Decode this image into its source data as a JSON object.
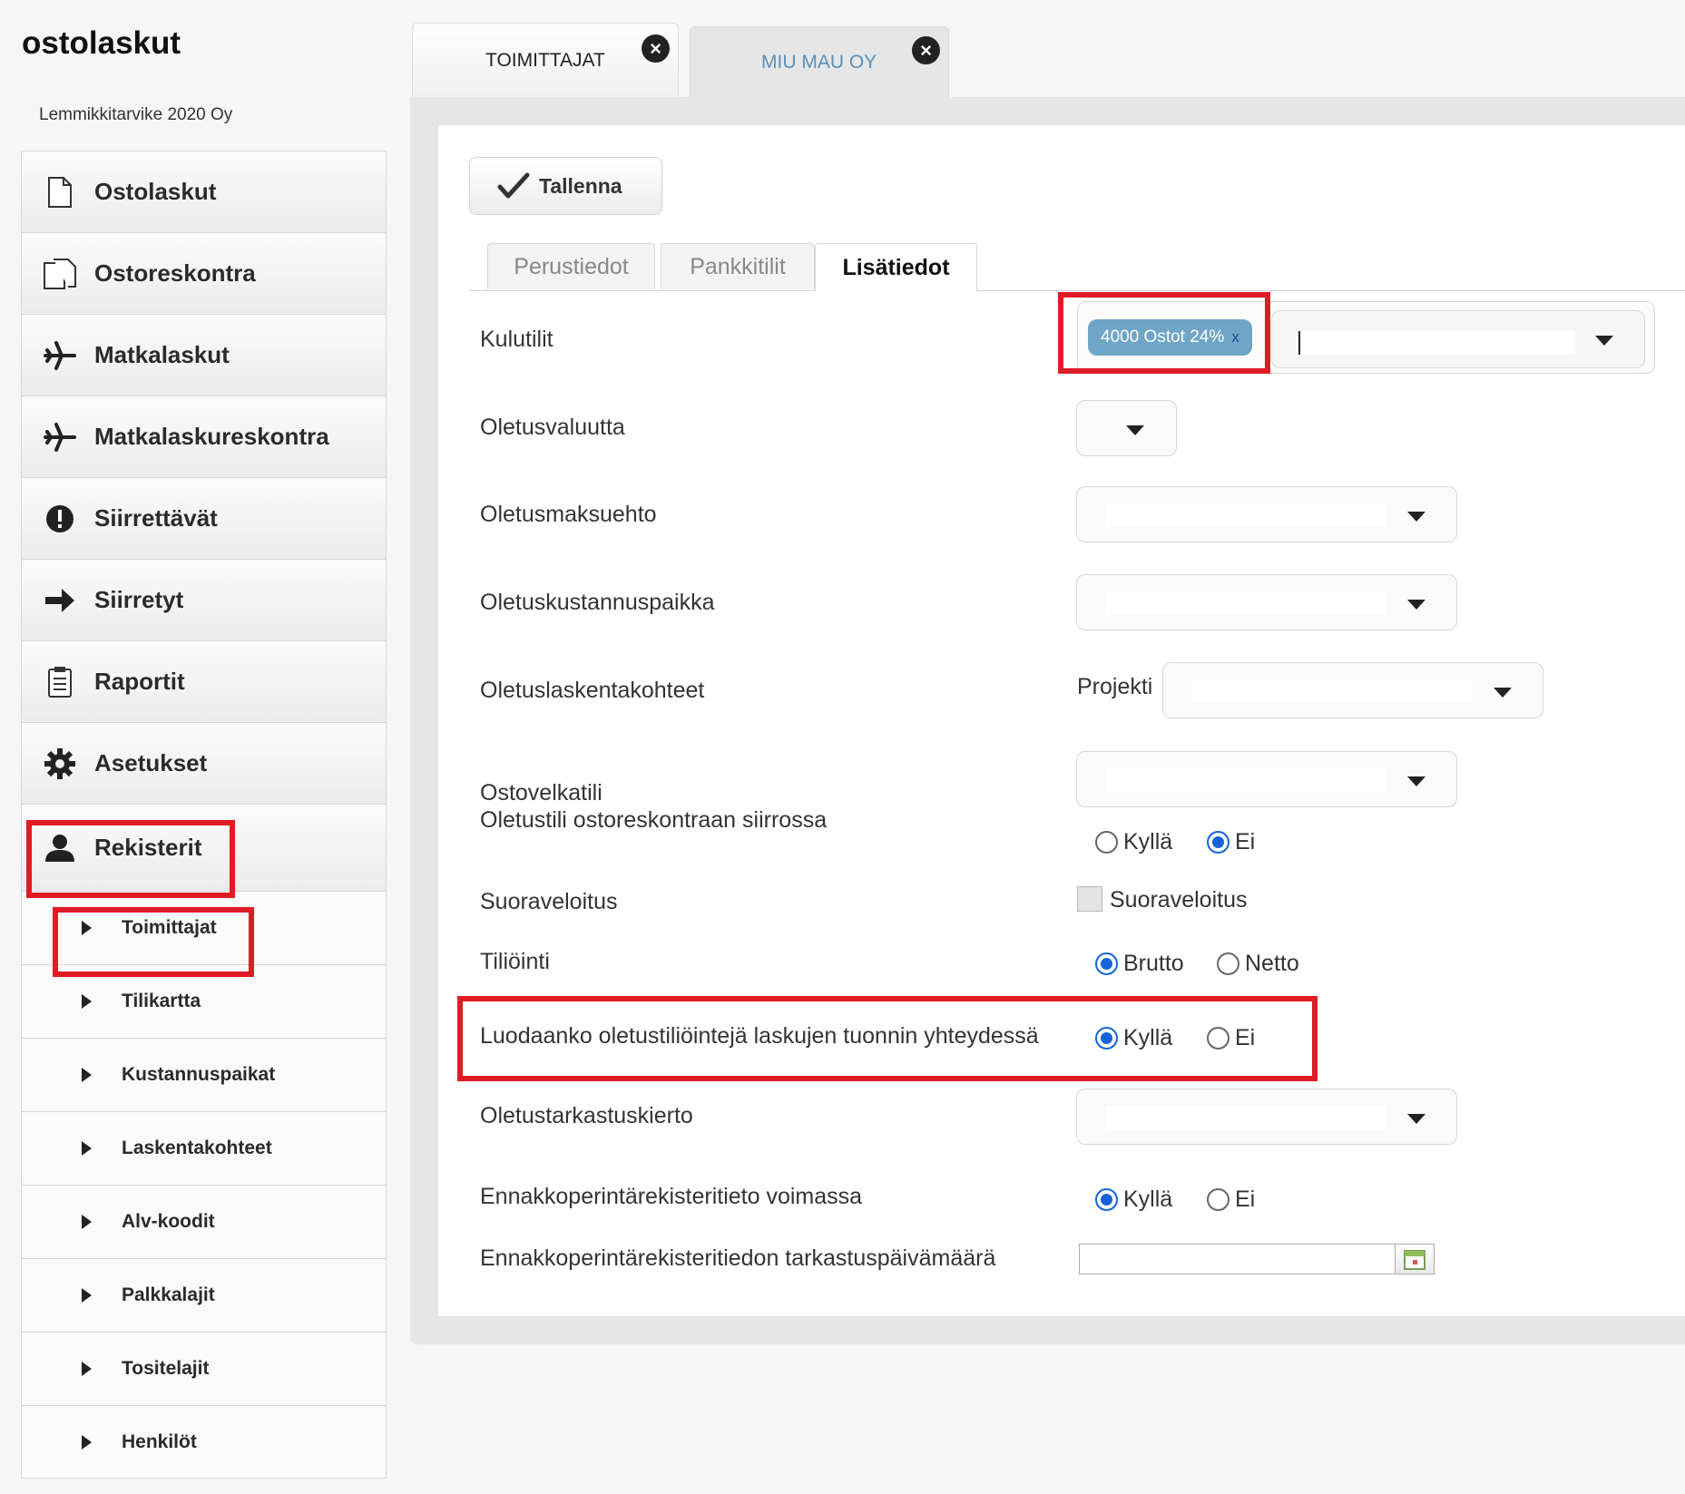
{
  "app": {
    "title": "ostolaskut",
    "company": "Lemmikkitarvike 2020 Oy"
  },
  "sidebar": {
    "items": [
      {
        "label": "Ostolaskut",
        "icon": "document-icon"
      },
      {
        "label": "Ostoreskontra",
        "icon": "documents-icon"
      },
      {
        "label": "Matkalaskut",
        "icon": "airplane-icon"
      },
      {
        "label": "Matkalaskureskontra",
        "icon": "airplane-icon"
      },
      {
        "label": "Siirrettävät",
        "icon": "alert-icon"
      },
      {
        "label": "Siirretyt",
        "icon": "arrow-right-icon"
      },
      {
        "label": "Raportit",
        "icon": "report-icon"
      },
      {
        "label": "Asetukset",
        "icon": "gear-icon"
      },
      {
        "label": "Rekisterit",
        "icon": "user-icon"
      }
    ],
    "subitems": [
      {
        "label": "Toimittajat"
      },
      {
        "label": "Tilikartta"
      },
      {
        "label": "Kustannuspaikat"
      },
      {
        "label": "Laskentakohteet"
      },
      {
        "label": "Alv-koodit"
      },
      {
        "label": "Palkkalajit"
      },
      {
        "label": "Tositelajit"
      },
      {
        "label": "Henkilöt"
      }
    ]
  },
  "tabs": [
    {
      "label": "TOIMITTAJAT",
      "color": "#222222"
    },
    {
      "label": "MIU MAU OY",
      "color": "#5b8fb9"
    }
  ],
  "toolbar": {
    "save_label": "Tallenna"
  },
  "subtabs": [
    {
      "label": "Perustiedot"
    },
    {
      "label": "Pankkitilit"
    },
    {
      "label": "Lisätiedot"
    }
  ],
  "form": {
    "kulutilit": {
      "label": "Kulutilit",
      "tag": "4000 Ostot 24%",
      "tag_remove": "x"
    },
    "oletusvaluutta": {
      "label": "Oletusvaluutta"
    },
    "oletusmaksuehto": {
      "label": "Oletusmaksuehto"
    },
    "oletuskustannuspaikka": {
      "label": "Oletuskustannuspaikka"
    },
    "oletuslaskentakohteet": {
      "label": "Oletuslaskentakohteet",
      "sublabel": "Projekti"
    },
    "ostovelkatili": {
      "label": "Ostovelkatili",
      "label2": "Oletustili ostoreskontraan siirrossa",
      "yes": "Kyllä",
      "no": "Ei",
      "selected": "Ei"
    },
    "suoraveloitus": {
      "label": "Suoraveloitus",
      "checkbox_label": "Suoraveloitus"
    },
    "tiliointi": {
      "label": "Tiliöinti",
      "opt1": "Brutto",
      "opt2": "Netto",
      "selected": "Brutto"
    },
    "luodaanko": {
      "label": "Luodaanko oletustiliöintejä laskujen tuonnin yhteydessä",
      "yes": "Kyllä",
      "no": "Ei",
      "selected": "Kyllä"
    },
    "oletustarkastuskierto": {
      "label": "Oletustarkastuskierto"
    },
    "ennakkoperinta": {
      "label": "Ennakkoperintärekisteritieto voimassa",
      "yes": "Kyllä",
      "no": "Ei",
      "selected": "Kyllä"
    },
    "tarkastuspvm": {
      "label": "Ennakkoperintärekisteritiedon tarkastuspäivämäärä",
      "value": ""
    }
  },
  "colors": {
    "accent": "#1565d8",
    "highlight": "#dd1c25",
    "tag": "#6fa5c6"
  }
}
